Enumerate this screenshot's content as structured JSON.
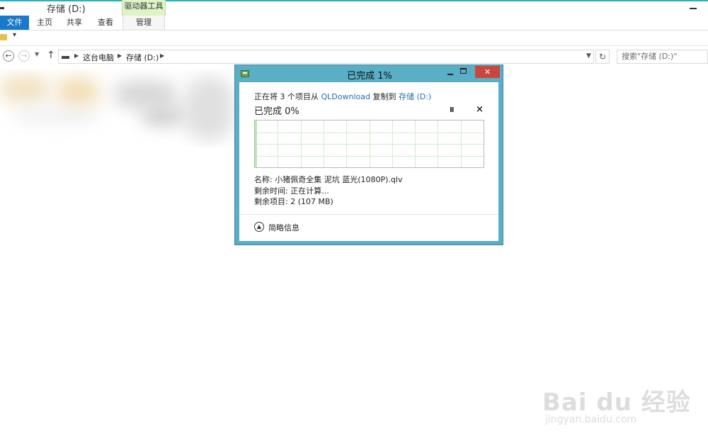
{
  "window": {
    "title": "存储 (D:)",
    "tools_tab": "驱动器工具"
  },
  "ribbon": {
    "tabs": [
      "文件",
      "主页",
      "共享",
      "查看",
      "管理"
    ]
  },
  "address": {
    "crumbs": [
      "这台电脑",
      "存储 (D:)"
    ],
    "search_placeholder": "搜索\"存储 (D:)\""
  },
  "dialog": {
    "title": "已完成 1%",
    "copying_prefix": "正在将 3 个项目从",
    "source": "QLDownload",
    "copy_to": "复制到",
    "destination": "存储 (D:)",
    "progress_heading": "已完成 0%",
    "pause_symbol": "II",
    "cancel_symbol": "×",
    "name_line": "名称: 小猪佩奇全集 泥坑 蓝光(1080P).qlv",
    "time_line": "剩余时间: 正在计算...",
    "items_line": "剩余项目: 2 (107 MB)",
    "brief_label": "简略信息",
    "progress_fraction": 0.01,
    "colors": {
      "frame": "#5aaec5",
      "close": "#c9463d",
      "progress": "#06b025"
    }
  },
  "watermark": {
    "main": "Bai du 经验",
    "sub": "jingyan.baidu.com"
  }
}
